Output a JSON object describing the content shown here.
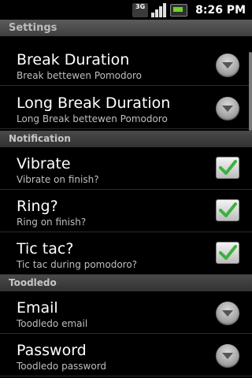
{
  "status_bar": {
    "network": "3G",
    "time": "8:26 PM"
  },
  "title": "Settings",
  "items": [
    {
      "title": "Break Duration",
      "summary": "Break bettewen Pomodoro",
      "control": "dropdown"
    },
    {
      "title": "Long Break Duration",
      "summary": "Long Break bettewen Pomodoro",
      "control": "dropdown"
    },
    {
      "title": "Vibrate",
      "summary": "Vibrate on finish?",
      "control": "checkbox",
      "checked": true
    },
    {
      "title": "Ring?",
      "summary": "Ring on finish?",
      "control": "checkbox",
      "checked": true
    },
    {
      "title": "Tic tac?",
      "summary": "Tic tac during pomodoro?",
      "control": "checkbox",
      "checked": true
    },
    {
      "title": "Email",
      "summary": "Toodledo email",
      "control": "dropdown"
    },
    {
      "title": "Password",
      "summary": "Toodledo password",
      "control": "dropdown"
    }
  ],
  "categories": {
    "notification": "Notification",
    "toodledo": "Toodledo"
  },
  "colors": {
    "check_green": "#3db13d",
    "summary_gray": "#bfbfbf"
  }
}
